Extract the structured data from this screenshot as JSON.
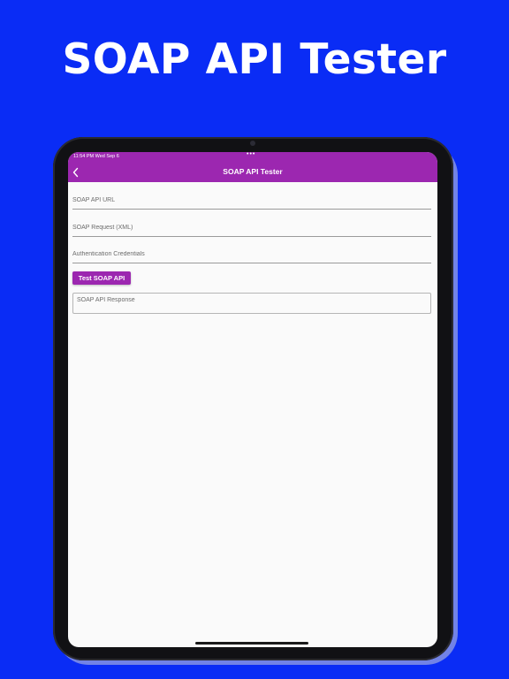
{
  "promo": {
    "title": "SOAP API Tester"
  },
  "status_bar": {
    "time_date": "11:54 PM   Wed Sep 6",
    "dots": "•••"
  },
  "app_bar": {
    "title": "SOAP API Tester",
    "back_icon": "chevron-left-icon"
  },
  "form": {
    "url_placeholder": "SOAP API URL",
    "request_placeholder": "SOAP Request (XML)",
    "credentials_placeholder": "Authentication Credentials",
    "test_button_label": "Test SOAP API",
    "response_placeholder": "SOAP API Response"
  },
  "colors": {
    "background": "#0a2cf5",
    "accent": "#9c27b0",
    "screen": "#fafafa"
  }
}
